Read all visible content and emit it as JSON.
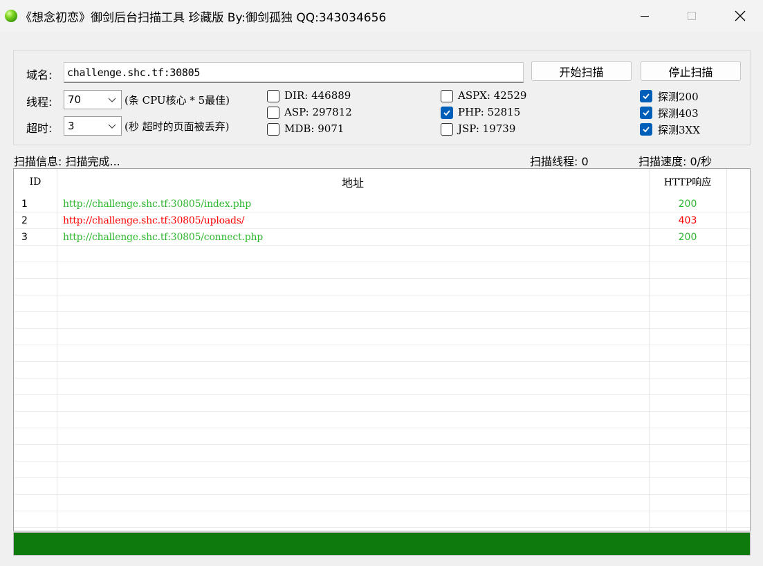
{
  "window": {
    "title": "《想念初恋》御剑后台扫描工具 珍藏版 By:御剑孤独 QQ:343034656",
    "icon": "green-orb-icon",
    "controls": [
      "minimize-icon",
      "maximize-icon",
      "close-icon"
    ]
  },
  "form": {
    "domain_label": "域名:",
    "domain_value": "challenge.shc.tf:30805",
    "start_button": "开始扫描",
    "stop_button": "停止扫描",
    "threads_label": "线程:",
    "threads_value": "70",
    "threads_hint": "(条 CPU核心 * 5最佳)",
    "timeout_label": "超时:",
    "timeout_value": "3",
    "timeout_hint": "(秒 超时的页面被丢弃)"
  },
  "dictionaries": [
    {
      "label": "DIR: 446889",
      "checked": false
    },
    {
      "label": "ASP: 297812",
      "checked": false
    },
    {
      "label": "MDB: 9071",
      "checked": false
    },
    {
      "label": "ASPX: 42529",
      "checked": false
    },
    {
      "label": "PHP: 52815",
      "checked": true
    },
    {
      "label": "JSP: 19739",
      "checked": false
    }
  ],
  "probes": [
    {
      "label": "探测200",
      "checked": true
    },
    {
      "label": "探测403",
      "checked": true
    },
    {
      "label": "探测3XX",
      "checked": true
    }
  ],
  "status": {
    "info": "扫描信息: 扫描完成...",
    "threads": "扫描线程: 0",
    "speed": "扫描速度: 0/秒"
  },
  "table": {
    "columns": [
      "ID",
      "地址",
      "HTTP响应"
    ],
    "rows": [
      {
        "id": "1",
        "url": "http://challenge.shc.tf:30805/index.php",
        "code": "200",
        "color": "#2db82d"
      },
      {
        "id": "2",
        "url": "http://challenge.shc.tf:30805/uploads/",
        "code": "403",
        "color": "#ff0000"
      },
      {
        "id": "3",
        "url": "http://challenge.shc.tf:30805/connect.php",
        "code": "200",
        "color": "#2db82d"
      }
    ]
  },
  "progress": {
    "fraction": 1.0,
    "color": "#0e7a0d"
  }
}
